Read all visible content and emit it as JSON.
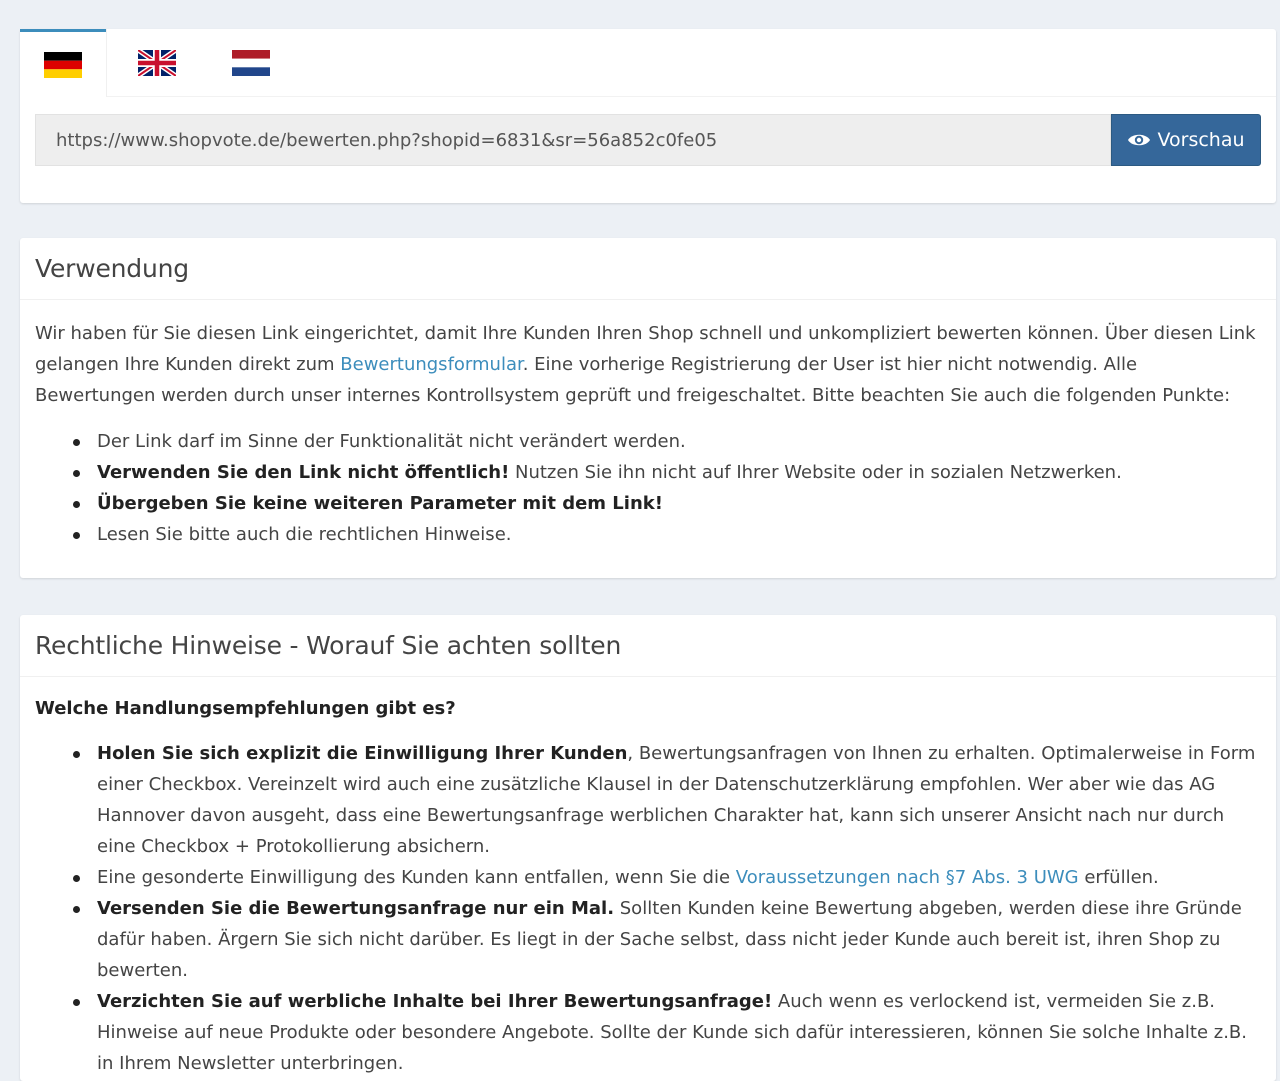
{
  "flags": {
    "de": {
      "icon": "flag-germany-icon",
      "colors": [
        "#000000",
        "#dd0000",
        "#ffce00"
      ]
    },
    "en": {
      "icon": "flag-uk-icon",
      "colors": [
        "#012169",
        "#ffffff",
        "#c8102e"
      ]
    },
    "nl": {
      "icon": "flag-netherlands-icon",
      "colors": [
        "#ae1c28",
        "#ffffff",
        "#21468b"
      ]
    }
  },
  "link_card": {
    "url": "https://www.shopvote.de/bewerten.php?shopid=6831&sr=56a852c0fe05",
    "preview_label": "Vorschau",
    "preview_icon": "eye-icon",
    "accent": "#35679a"
  },
  "usage": {
    "title": "Verwendung",
    "intro_1": "Wir haben für Sie diesen Link eingerichtet, damit Ihre Kunden Ihren Shop schnell und unkompliziert bewerten können. Über diesen Link gelangen Ihre Kunden direkt zum ",
    "intro_link": "Bewertungsformular",
    "intro_2": ". Eine vorherige Registrierung der User ist hier nicht notwendig. Alle Bewertungen werden durch unser internes Kontrollsystem geprüft und freigeschaltet. Bitte beachten Sie auch die folgenden Punkte:",
    "items": [
      {
        "bold": "",
        "text": "Der Link darf im Sinne der Funktionalität nicht verändert werden."
      },
      {
        "bold": "Verwenden Sie den Link nicht öffentlich!",
        "text": " Nutzen Sie ihn nicht auf Ihrer Website oder in sozialen Netzwerken."
      },
      {
        "bold": "Übergeben Sie keine weiteren Parameter mit dem Link!",
        "text": ""
      },
      {
        "bold": "",
        "text": "Lesen Sie bitte auch die rechtlichen Hinweise."
      }
    ]
  },
  "legal": {
    "title": "Rechtliche Hinweise - Worauf Sie achten sollten",
    "question": "Welche Handlungsempfehlungen gibt es?",
    "items": [
      {
        "bold": "Holen Sie sich explizit die Einwilligung Ihrer Kunden",
        "text": ", Bewertungsanfragen von Ihnen zu erhalten. Optimalerweise in Form einer Checkbox. Vereinzelt wird auch eine zusätzliche Klausel in der Datenschutzerklärung empfohlen. Wer aber wie das AG Hannover davon ausgeht, dass eine Bewertungsanfrage werblichen Charakter hat, kann sich unserer Ansicht nach nur durch eine Checkbox + Protokollierung absichern."
      },
      {
        "text_before": "Eine gesonderte Einwilligung des Kunden kann entfallen, wenn Sie die ",
        "link": "Voraussetzungen nach §7 Abs. 3 UWG",
        "text_after": " erfüllen."
      },
      {
        "bold": "Versenden Sie die Bewertungsanfrage nur ein Mal.",
        "text": " Sollten Kunden keine Bewertung abgeben, werden diese ihre Gründe dafür haben. Ärgern Sie sich nicht darüber. Es liegt in der Sache selbst, dass nicht jeder Kunde auch bereit ist, ihren Shop zu bewerten."
      },
      {
        "bold": "Verzichten Sie auf werbliche Inhalte bei Ihrer Bewertungsanfrage!",
        "text": " Auch wenn es verlockend ist, vermeiden Sie z.B. Hinweise auf neue Produkte oder besondere Angebote. Sollte der Kunde sich dafür interessieren, können Sie solche Inhalte z.B. in Ihrem Newsletter unterbringen."
      }
    ]
  }
}
